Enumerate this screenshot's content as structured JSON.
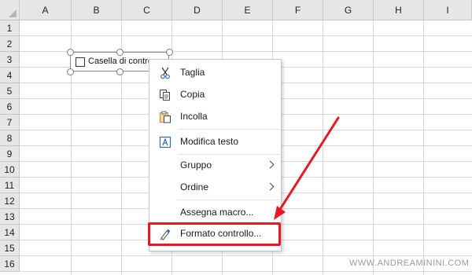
{
  "sheet": {
    "columns": [
      "A",
      "B",
      "C",
      "D",
      "E",
      "F",
      "G",
      "H",
      "I"
    ],
    "rows": [
      "1",
      "2",
      "3",
      "4",
      "5",
      "6",
      "7",
      "8",
      "9",
      "10",
      "11",
      "12",
      "13",
      "14",
      "15",
      "16"
    ]
  },
  "checkbox_control": {
    "label": "Casella di controllo",
    "checked": false
  },
  "context_menu": {
    "items": [
      {
        "label": "Taglia",
        "icon": "scissors-icon"
      },
      {
        "label": "Copia",
        "icon": "copy-icon"
      },
      {
        "label": "Incolla",
        "icon": "paste-icon"
      },
      {
        "label": "Modifica testo",
        "icon": "edit-text-icon"
      },
      {
        "label": "Gruppo",
        "icon": "",
        "submenu": true
      },
      {
        "label": "Ordine",
        "icon": "",
        "submenu": true
      },
      {
        "label": "Assegna macro...",
        "icon": ""
      },
      {
        "label": "Formato controllo...",
        "icon": "format-control-icon"
      }
    ]
  },
  "annotation": {
    "highlight_color": "#e8191f",
    "highlighted_item": "Formato controllo..."
  },
  "watermark": "WWW.ANDREAMININI.COM",
  "colors": {
    "header_bg": "#e6e6e6",
    "gridline": "#d9d9d9",
    "accent_blue": "#2f6db5",
    "icon_orange": "#d9822b"
  }
}
